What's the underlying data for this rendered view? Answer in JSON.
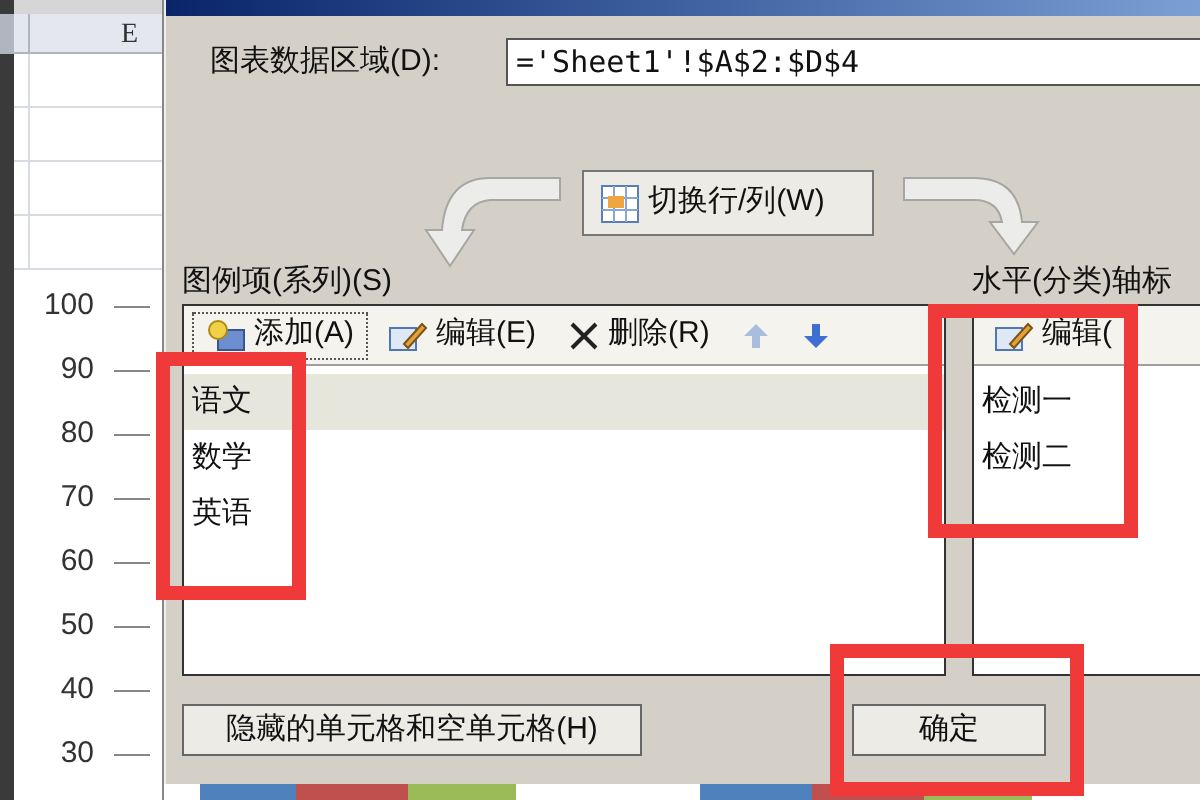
{
  "spreadsheet": {
    "column_header": "E"
  },
  "chart": {
    "axis_labels": [
      "100",
      "90",
      "80",
      "70",
      "60",
      "50",
      "40",
      "30"
    ]
  },
  "dialog": {
    "data_range": {
      "label": "图表数据区域(D):",
      "value": "='Sheet1'!$A$2:$D$4"
    },
    "switch_button": "切换行/列(W)",
    "legend": {
      "title": "图例项(系列)(S)",
      "toolbar": [
        {
          "kind": "add",
          "label": "添加(A)"
        },
        {
          "kind": "edit",
          "label": "编辑(E)"
        },
        {
          "kind": "delete",
          "label": "删除(R)"
        },
        {
          "kind": "up"
        },
        {
          "kind": "down"
        }
      ],
      "items": [
        {
          "label": "语文",
          "selected": true
        },
        {
          "label": "数学",
          "selected": false
        },
        {
          "label": "英语",
          "selected": false
        }
      ]
    },
    "axis": {
      "title": "水平(分类)轴标",
      "toolbar": [
        {
          "kind": "edit",
          "label": "编辑("
        }
      ],
      "items": [
        {
          "label": "检测一",
          "selected": false
        },
        {
          "label": "检测二",
          "selected": false
        }
      ]
    },
    "hidden_cells_button": "隐藏的单元格和空单元格(H)",
    "ok_button": "确定"
  }
}
